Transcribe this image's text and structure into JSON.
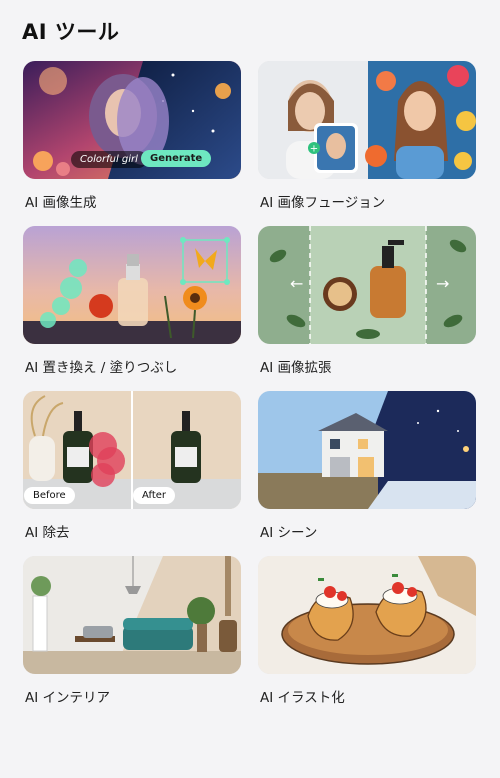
{
  "header": {
    "title": "AI ツール"
  },
  "tools": [
    {
      "label": "AI 画像生成",
      "overlay_text": "Colorful girl",
      "button": "Generate"
    },
    {
      "label": "AI 画像フュージョン"
    },
    {
      "label": "AI 置き換え / 塗りつぶし"
    },
    {
      "label": "AI 画像拡張"
    },
    {
      "label": "AI 除去",
      "before": "Before",
      "after": "After"
    },
    {
      "label": "AI シーン"
    },
    {
      "label": "AI インテリア"
    },
    {
      "label": "AI イラスト化"
    }
  ],
  "colors": {
    "accent": "#6ee8c0",
    "background": "#f4f4f6"
  }
}
